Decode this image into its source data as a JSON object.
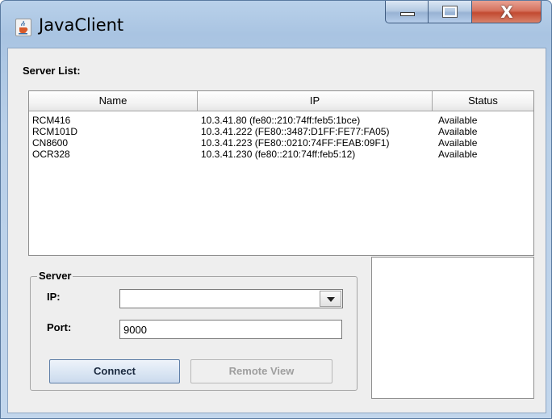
{
  "window": {
    "title": "JavaClient",
    "app_icon": "java-cup-icon",
    "close_glyph": "X"
  },
  "server_list": {
    "label": "Server List:",
    "columns": [
      "Name",
      "IP",
      "Status"
    ],
    "rows": [
      {
        "name": "RCM416",
        "ip": "10.3.41.80 (fe80::210:74ff:feb5:1bce)",
        "status": "Available"
      },
      {
        "name": "RCM101D",
        "ip": "10.3.41.222 (FE80::3487:D1FF:FE77:FA05)",
        "status": "Available"
      },
      {
        "name": "CN8600",
        "ip": "10.3.41.223 (FE80::0210:74FF:FEAB:09F1)",
        "status": "Available"
      },
      {
        "name": "OCR328",
        "ip": "10.3.41.230 (fe80::210:74ff:feb5:12)",
        "status": "Available"
      }
    ]
  },
  "server": {
    "legend": "Server",
    "ip_label": "IP:",
    "ip_value": "",
    "port_label": "Port:",
    "port_value": "9000",
    "connect_label": "Connect",
    "remote_view_label": "Remote View"
  }
}
